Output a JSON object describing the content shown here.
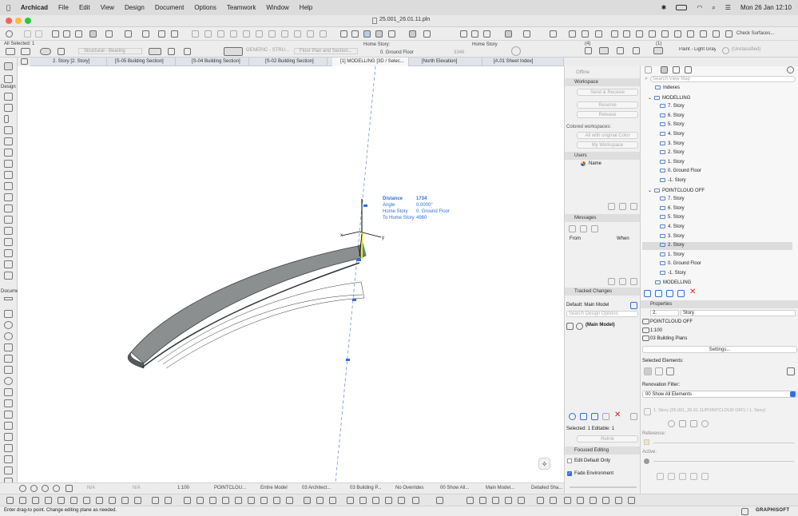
{
  "menubar": {
    "apple": "",
    "app": "Archicad",
    "items": [
      "File",
      "Edit",
      "View",
      "Design",
      "Document",
      "Options",
      "Teamwork",
      "Window",
      "Help"
    ],
    "datetime": "Mon 26 Jan  12:10"
  },
  "window": {
    "title": "25.001_26.01.11.pln"
  },
  "toolbar": {
    "all_selected": "All Selected: 1",
    "structural_bearing": "Structural - Bearing",
    "generic_stru": "GENERIC - STRU...",
    "floor_plan_section": "Floor Plan and Section...",
    "home_story_label": "Home Story:",
    "home_story_value": "0. Ground Floor",
    "home_story_short": "Home Story",
    "value_3346": "3346",
    "check_surfaces": "Check Surfaces...",
    "paint_value": "Paint - Light Gray Matte",
    "unclassified": "(Unclassified)",
    "layer_count_1": "(4)",
    "layer_count_2": "(1)"
  },
  "tabs": [
    "2. Story [2. Story]",
    "[S-05 Building Section]",
    "[S-04 Building Section]",
    "[S-02 Building Section]",
    "[1] MODELLING [3D / Selec...",
    "[North Elevation]",
    "[A.01 Sheet Index]"
  ],
  "toolbox": {
    "arrow": "Arrow",
    "design": "Design",
    "document": "Docume",
    "marquee": "Marquee"
  },
  "tracker": {
    "distance_label": "Distance",
    "distance_value": "1734",
    "angle_label": "Angle",
    "angle_value": "0.0000°",
    "home_story_label": "Home Story",
    "home_story_value": "0. Ground Floor",
    "to_home_story_label": "To Home Story",
    "to_home_story_value": "4980",
    "axis_x": "x",
    "axis_y": "y"
  },
  "bottombar": {
    "na1": "N/A",
    "na2": "N/A",
    "scale": "1:100",
    "pointcloud": "POINTCLOU...",
    "entire_model": "Entire Model",
    "architect": "03 Architect...",
    "building_p": "03 Building P...",
    "no_overrides": "No Overrides",
    "show_all": "00 Show All...",
    "main_model": "Main Model...",
    "detailed": "Detailed Sha..."
  },
  "status": {
    "hint": "Enter drag-to point. Change editing plane as needed.",
    "brand": "GRAPHISOFT"
  },
  "teamwork": {
    "offline": "Offline",
    "workspace": "Workspace",
    "send_receive": "Send & Receive",
    "reserve": "Reserve",
    "release": "Release",
    "colored_workspaces": "Colored workspaces:",
    "all_original": "All with original Color",
    "my_workspace": "My Workspace",
    "users": "Users",
    "name_col": "Name",
    "messages": "Messages",
    "from_col": "From",
    "when_col": "When",
    "tracked_changes": "Tracked Changes",
    "default_main": "Default: Main Model",
    "search_design": "Search Design Options",
    "main_model": "(Main Model)",
    "selected_editable": "Selected: 1 Editable: 1",
    "relink": "Relink",
    "focused_editing": "Focused Editing",
    "edit_default": "Edit Default Only",
    "fade_env": "Fade Environment"
  },
  "navigator": {
    "search_placeholder": "Search View Map",
    "indexes": "Indexes",
    "modelling": "MODELLING",
    "modelling_items": [
      "7. Story",
      "6. Story",
      "5. Story",
      "4. Story",
      "3. Story",
      "2. Story",
      "1. Story",
      "0. Ground Floor",
      "-1. Story"
    ],
    "pointcloud_off": "POINTCLOUD OFF",
    "pointcloud_items": [
      "7. Story",
      "6. Story",
      "5. Story",
      "4. Story",
      "3. Story",
      "2. Story",
      "1. Story",
      "0. Ground Floor",
      "-1. Story"
    ],
    "modelling_last": "MODELLING"
  },
  "properties": {
    "title": "Properties",
    "story_num": "2.",
    "story_name": "Story",
    "layer_combo": "POINTCLOUD OFF",
    "scale": "1:100",
    "pen_set": "03 Building Plans",
    "settings": "Settings...",
    "selected_elements": "Selected Elements:",
    "renovation_filter": "Renovation Filter:",
    "renovation_value": "00 Show All Elements",
    "source": "1. Story (25.001_26.01.11/POINTCLOUD OFF) / 1. Story)",
    "reference": "Reference:",
    "active": "Active:"
  }
}
